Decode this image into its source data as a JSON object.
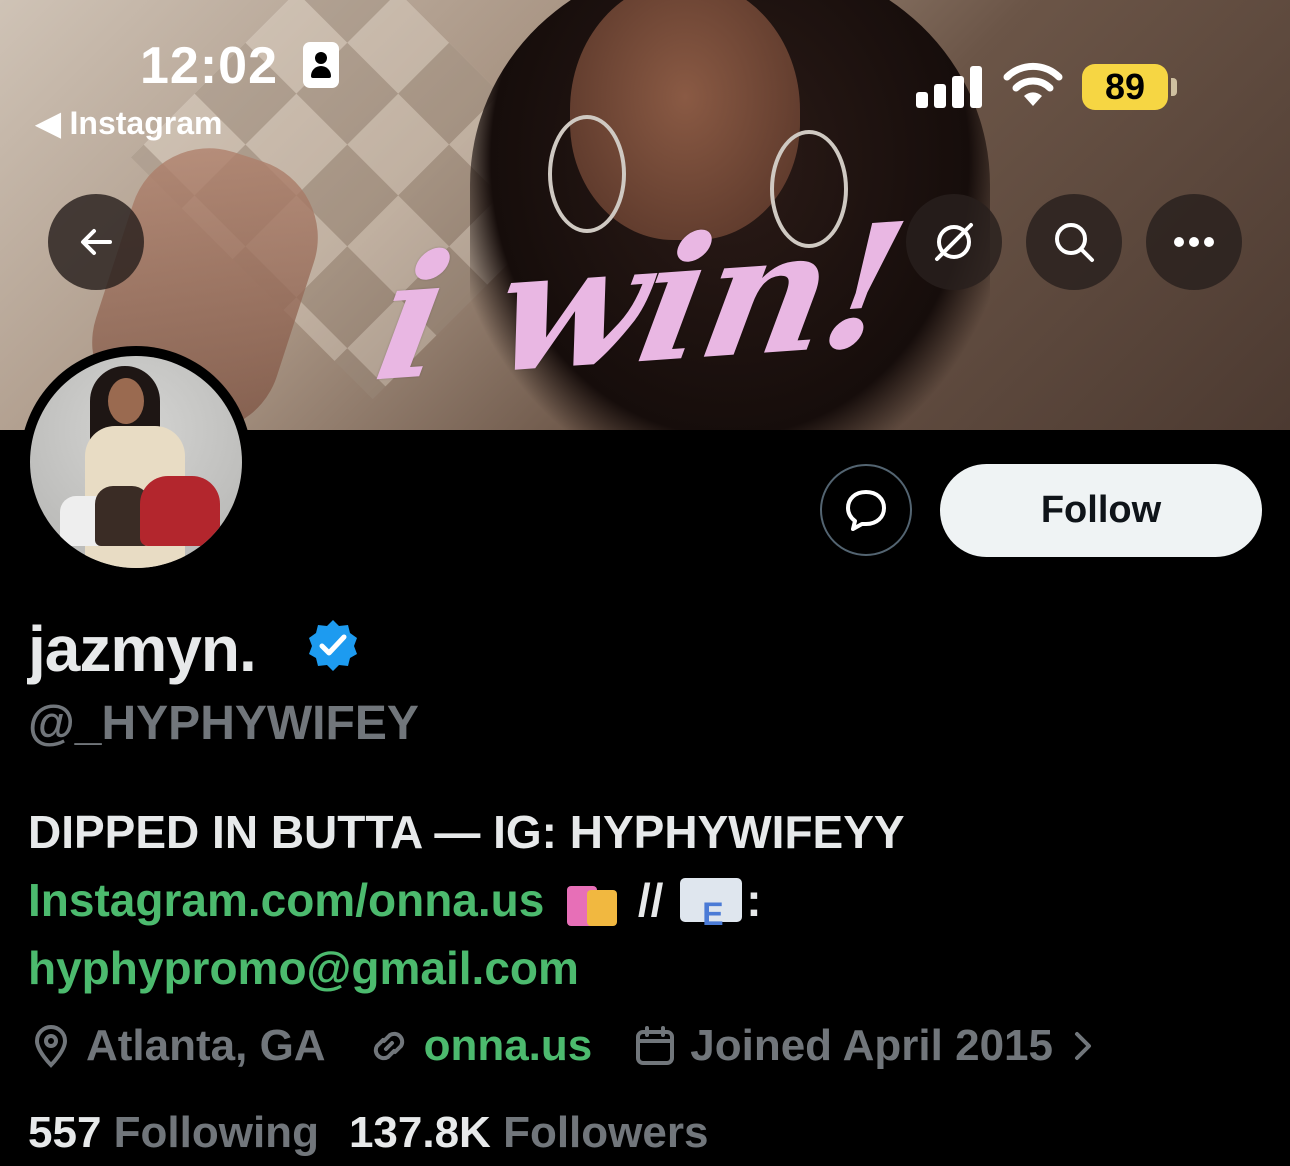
{
  "status_bar": {
    "time": "12:02",
    "back_app": "◀ Instagram",
    "battery": "89"
  },
  "banner": {
    "overlay_text": "i win!"
  },
  "icons": {
    "back": "back-arrow-icon",
    "grok": "grok-icon",
    "search": "search-icon",
    "more": "more-icon",
    "message": "message-icon",
    "verified": "verified-badge-icon",
    "location": "location-icon",
    "link": "link-icon",
    "calendar": "calendar-icon",
    "chevron": "chevron-right-icon"
  },
  "profile": {
    "display_name": "jazmyn.",
    "handle": "@_HYPHYWIFEY",
    "bio_line1": "DIPPED IN BUTTA — IG: HYPHYWIFEYY",
    "bio_link": "Instagram.com/onna.us",
    "bio_sep": " // ",
    "bio_colon": ":",
    "bio_email": "hyphypromo@gmail.com",
    "location": "Atlanta, GA",
    "website": "onna.us",
    "joined": "Joined April 2015",
    "following_count": "557",
    "following_label": "Following",
    "followers_count": "137.8K",
    "followers_label": "Followers"
  },
  "actions": {
    "follow_label": "Follow"
  },
  "colors": {
    "background": "#000000",
    "text_primary": "#e7e9ea",
    "text_secondary": "#71767b",
    "link_green": "#4cba6e",
    "verified_blue": "#1d9bf0",
    "battery_yellow": "#f6d643",
    "banner_text_pink": "#e9b7e3"
  }
}
